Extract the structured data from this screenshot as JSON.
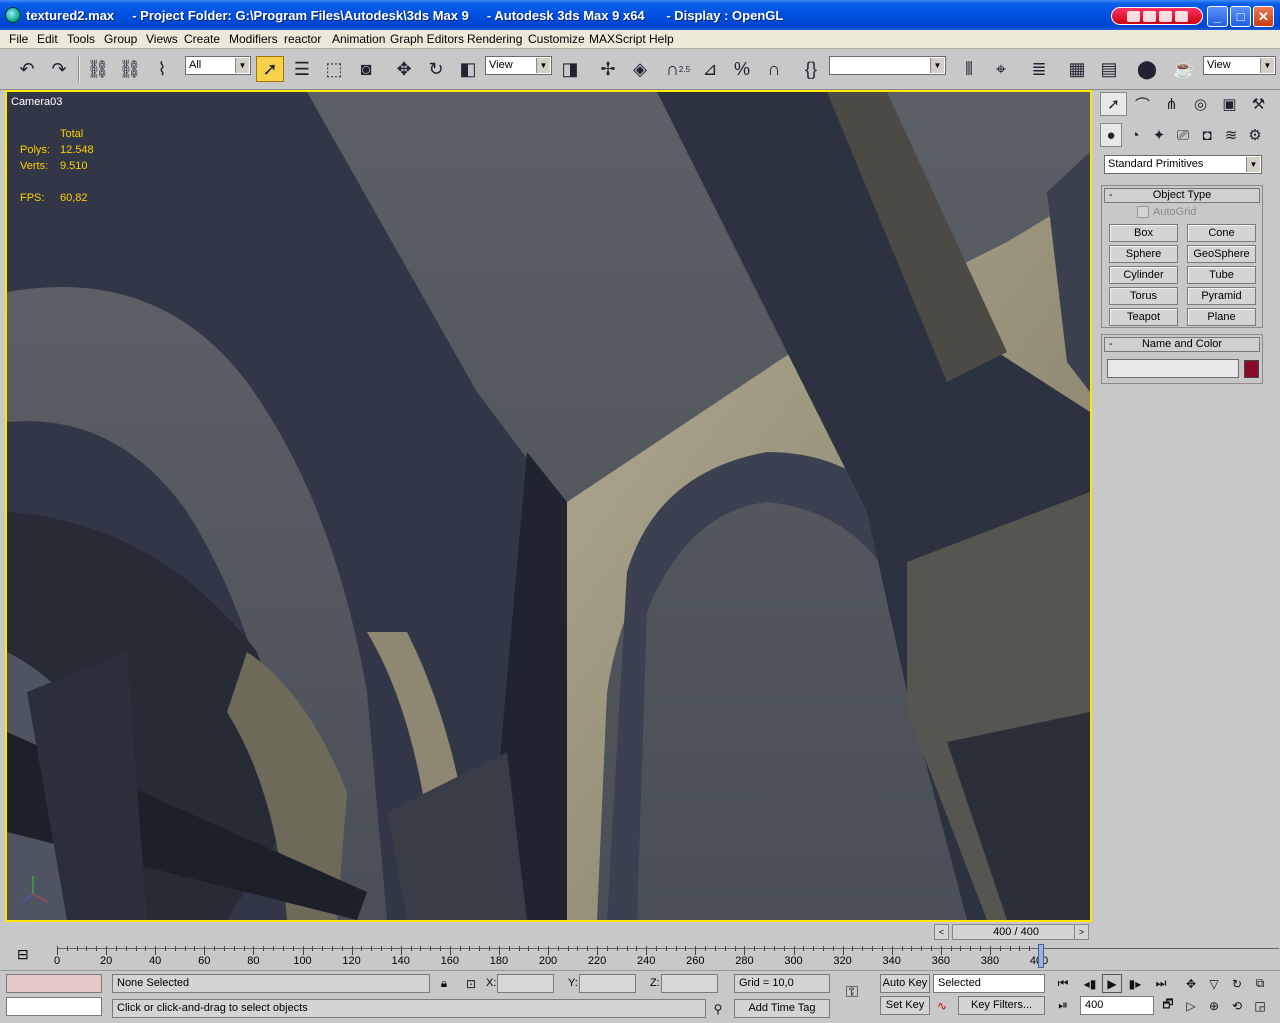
{
  "window": {
    "title": "textured2.max     - Project Folder: G:\\Program Files\\Autodesk\\3ds Max 9     - Autodesk 3ds Max 9 x64      - Display : OpenGL",
    "minimize": "_",
    "maximize": "□",
    "close": "✕"
  },
  "menu": [
    "File",
    "Edit",
    "Tools",
    "Group",
    "Views",
    "Create",
    "Modifiers",
    "reactor",
    "Animation",
    "Graph Editors",
    "Rendering",
    "Customize",
    "MAXScript",
    "Help"
  ],
  "toolbar": {
    "selection_filter": "All",
    "coord_system": "View",
    "named_selection": "",
    "viewport_select": "View",
    "angle_snap_label": "2.5"
  },
  "viewport": {
    "label": "Camera03",
    "stats": {
      "header": "Total",
      "polys_label": "Polys:",
      "polys": "12.548",
      "verts_label": "Verts:",
      "verts": "9.510",
      "fps_label": "FPS:",
      "fps": "60,82"
    },
    "colors": {
      "border": "#ffe600",
      "sky": "#5f646a",
      "stone_light": "#a79f86",
      "stone_dark": "#2f3542"
    }
  },
  "command_panel": {
    "category": "Standard Primitives",
    "object_type": {
      "header": "Object Type",
      "autogrid": "AutoGrid",
      "buttons": [
        "Box",
        "Cone",
        "Sphere",
        "GeoSphere",
        "Cylinder",
        "Tube",
        "Torus",
        "Pyramid",
        "Teapot",
        "Plane"
      ]
    },
    "name_color": {
      "header": "Name and Color",
      "name_value": "",
      "color": "#8a0a2c"
    }
  },
  "timeline": {
    "frame_display": "400 / 400",
    "prev": "<",
    "next": ">",
    "tick_labels": [
      "0",
      "20",
      "40",
      "60",
      "80",
      "100",
      "120",
      "140",
      "160",
      "180",
      "200",
      "220",
      "240",
      "260",
      "280",
      "300",
      "320",
      "340",
      "360",
      "380",
      "400"
    ]
  },
  "status": {
    "selection": "None Selected",
    "prompt": "Click or click-and-drag to select objects",
    "x_label": "X:",
    "y_label": "Y:",
    "z_label": "Z:",
    "x": "",
    "y": "",
    "z": "",
    "grid": "Grid = 10,0",
    "add_time_tag": "Add Time Tag",
    "auto_key": "Auto Key",
    "set_key": "Set Key",
    "key_mode": "Selected",
    "key_filters": "Key Filters...",
    "current_frame": "400"
  }
}
